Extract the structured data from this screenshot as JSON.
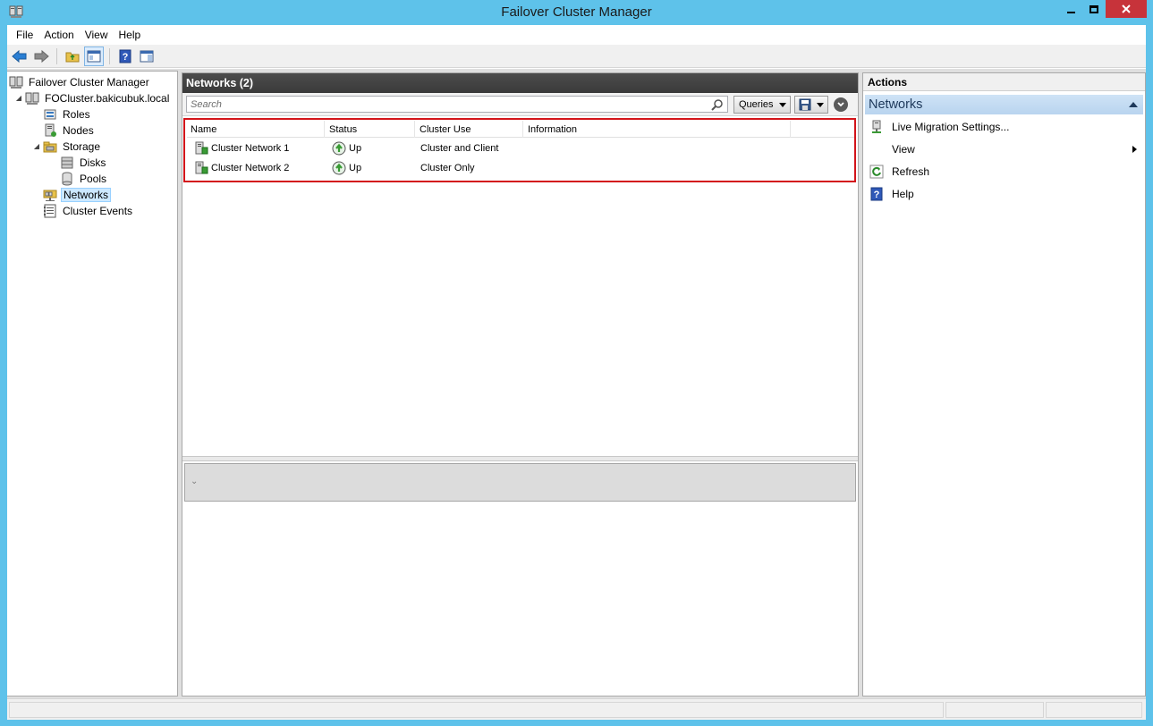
{
  "window": {
    "title": "Failover Cluster Manager",
    "icon": "cluster-manager-icon"
  },
  "menu": [
    "File",
    "Action",
    "View",
    "Help"
  ],
  "toolbar": {
    "buttons": [
      "back-arrow-icon",
      "forward-arrow-icon",
      "up-folder-icon",
      "show-hide-console-tree-icon",
      "help-icon",
      "show-hide-action-pane-icon"
    ]
  },
  "tree": {
    "root": "Failover Cluster Manager",
    "cluster": "FOCluster.bakicubuk.local",
    "roles": "Roles",
    "nodes": "Nodes",
    "storage": "Storage",
    "disks": "Disks",
    "pools": "Pools",
    "networks": "Networks",
    "events": "Cluster Events"
  },
  "center": {
    "title": "Networks (2)",
    "search_placeholder": "Search",
    "queries_label": "Queries",
    "columns": [
      "Name",
      "Status",
      "Cluster Use",
      "Information"
    ],
    "rows": [
      {
        "name": "Cluster Network 1",
        "status": "Up",
        "use": "Cluster and Client",
        "info": ""
      },
      {
        "name": "Cluster Network 2",
        "status": "Up",
        "use": "Cluster Only",
        "info": ""
      }
    ]
  },
  "actions": {
    "title": "Actions",
    "section": "Networks",
    "items": [
      {
        "label": "Live Migration Settings...",
        "icon": "live-migration-icon"
      },
      {
        "label": "View",
        "icon": ""
      },
      {
        "label": "Refresh",
        "icon": "refresh-icon"
      },
      {
        "label": "Help",
        "icon": "help-icon"
      }
    ]
  },
  "colors": {
    "titlebar": "#5ec2ea",
    "close_button": "#c7333a",
    "highlight_outline": "#d3141a",
    "status_up": "#3a9b35"
  }
}
